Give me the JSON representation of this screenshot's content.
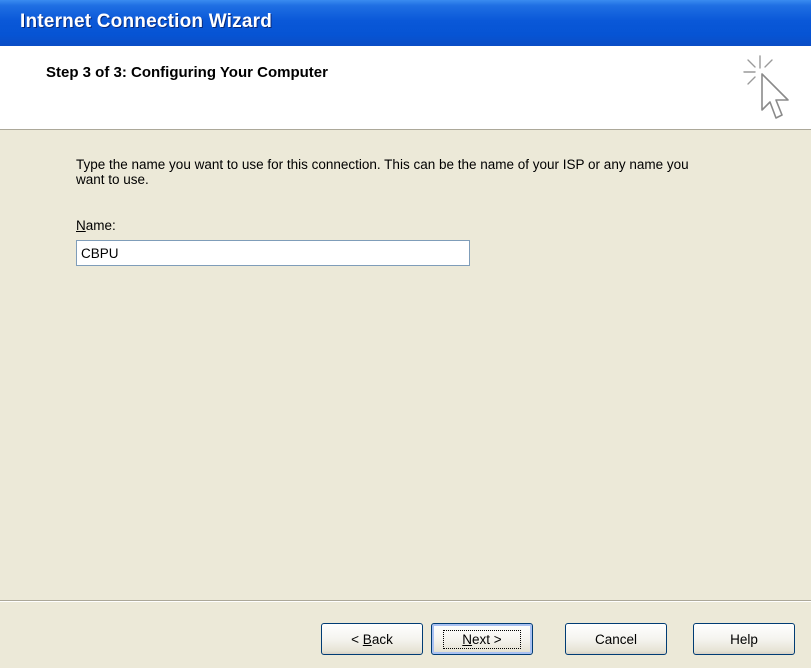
{
  "window": {
    "title": "Internet Connection Wizard"
  },
  "header": {
    "step_title": "Step 3 of 3: Configuring Your Computer",
    "icon": "wizard-cursor-icon"
  },
  "content": {
    "instruction": "Type the name you want to use for this connection. This can be the name of your ISP or any name you want to use.",
    "name_label_accel": "N",
    "name_label_rest": "ame:",
    "name_value": "CBPU"
  },
  "buttons": {
    "back_prefix": "< ",
    "back_accel": "B",
    "back_rest": "ack",
    "next_accel": "N",
    "next_rest": "ext >",
    "cancel": "Cancel",
    "help": "Help"
  }
}
